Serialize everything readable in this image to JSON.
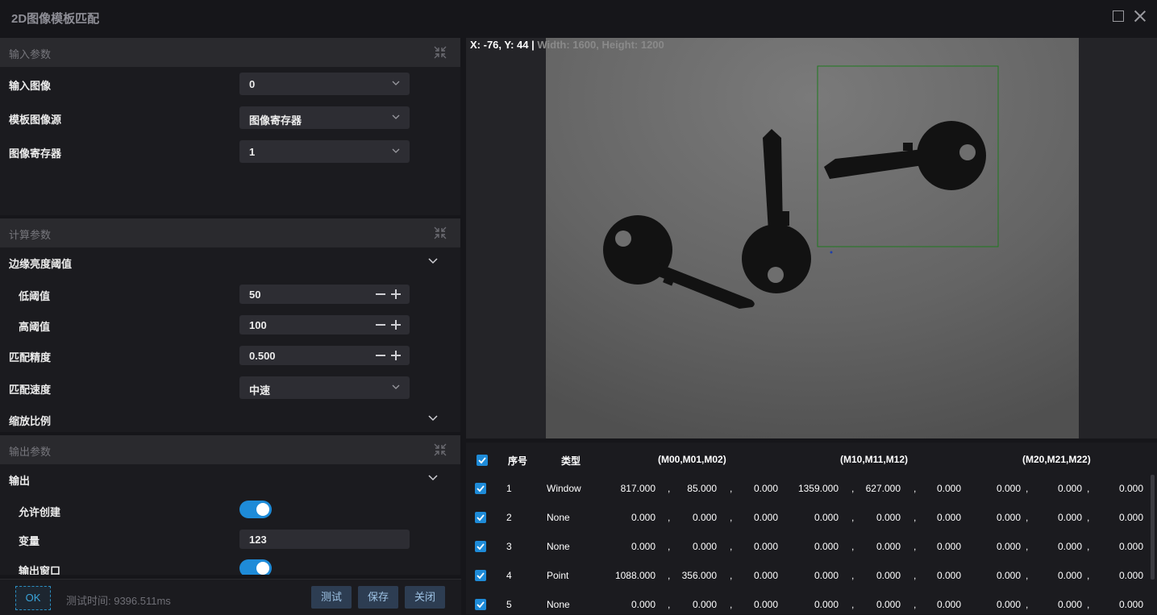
{
  "window": {
    "title": "2D图像模板匹配"
  },
  "sections": {
    "input": {
      "title": "输入参数",
      "input_image": {
        "label": "输入图像",
        "value": "0"
      },
      "template_source": {
        "label": "模板图像源",
        "value": "图像寄存器"
      },
      "image_register": {
        "label": "图像寄存器",
        "value": "1"
      }
    },
    "calc": {
      "title": "计算参数",
      "edge_threshold": {
        "label": "边缘亮度阈值"
      },
      "low_threshold": {
        "label": "低阈值",
        "value": "50"
      },
      "high_threshold": {
        "label": "高阈值",
        "value": "100"
      },
      "match_precision": {
        "label": "匹配精度",
        "value": "0.500"
      },
      "match_speed": {
        "label": "匹配速度",
        "value": "中速"
      },
      "scale": {
        "label": "缩放比例"
      }
    },
    "output": {
      "title": "输出参数",
      "output": {
        "label": "输出"
      },
      "allow_create": {
        "label": "允许创建",
        "enabled": true
      },
      "variable": {
        "label": "变量",
        "value": "123"
      },
      "output_window": {
        "label": "输出窗口",
        "enabled": true
      }
    }
  },
  "footer": {
    "ok": "OK",
    "test_time": "测试时间: 9396.511ms",
    "test": "测试",
    "save": "保存",
    "close": "关闭"
  },
  "image_view": {
    "coords": "X: -76, Y: 44",
    "separator": "|",
    "size": "Width: 1600, Height: 1200"
  },
  "table": {
    "headers": {
      "index": "序号",
      "type": "类型",
      "m0": "(M00,M01,M02)",
      "m1": "(M10,M11,M12)",
      "m2": "(M20,M21,M22)"
    },
    "separator": ",",
    "rows": [
      {
        "checked": true,
        "index": "1",
        "type": "Window",
        "m": [
          "817.000",
          "85.000",
          "0.000",
          "1359.000",
          "627.000",
          "0.000",
          "0.000",
          "0.000",
          "0.000"
        ]
      },
      {
        "checked": true,
        "index": "2",
        "type": "None",
        "m": [
          "0.000",
          "0.000",
          "0.000",
          "0.000",
          "0.000",
          "0.000",
          "0.000",
          "0.000",
          "0.000"
        ]
      },
      {
        "checked": true,
        "index": "3",
        "type": "None",
        "m": [
          "0.000",
          "0.000",
          "0.000",
          "0.000",
          "0.000",
          "0.000",
          "0.000",
          "0.000",
          "0.000"
        ]
      },
      {
        "checked": true,
        "index": "4",
        "type": "Point",
        "m": [
          "1088.000",
          "356.000",
          "0.000",
          "0.000",
          "0.000",
          "0.000",
          "0.000",
          "0.000",
          "0.000"
        ]
      },
      {
        "checked": true,
        "index": "5",
        "type": "None",
        "m": [
          "0.000",
          "0.000",
          "0.000",
          "0.000",
          "0.000",
          "0.000",
          "0.000",
          "0.000",
          "0.000"
        ]
      }
    ]
  },
  "colors": {
    "accent": "#1e8bd8",
    "roi": "#1f7a1f",
    "background": "#16161a",
    "panel": "#1b1b1f"
  }
}
